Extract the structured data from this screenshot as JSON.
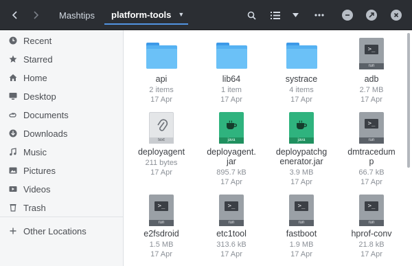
{
  "header": {
    "breadcrumb_home": "Mashtips",
    "breadcrumb_current": "platform-tools",
    "icons": {
      "back": "chevron-left-icon",
      "forward": "chevron-right-icon",
      "search": "search-icon",
      "view": "list-view-icon",
      "view_menu": "caret-down-icon",
      "menu": "more-icon",
      "minimize": "minimize-icon",
      "maximize": "maximize-icon",
      "close": "close-icon"
    }
  },
  "sidebar": {
    "items": [
      {
        "label": "Recent",
        "icon": "clock-icon"
      },
      {
        "label": "Starred",
        "icon": "star-icon"
      },
      {
        "label": "Home",
        "icon": "home-icon"
      },
      {
        "label": "Desktop",
        "icon": "desktop-icon"
      },
      {
        "label": "Documents",
        "icon": "documents-icon"
      },
      {
        "label": "Downloads",
        "icon": "download-icon"
      },
      {
        "label": "Music",
        "icon": "music-icon"
      },
      {
        "label": "Pictures",
        "icon": "pictures-icon"
      },
      {
        "label": "Videos",
        "icon": "videos-icon"
      },
      {
        "label": "Trash",
        "icon": "trash-icon"
      }
    ],
    "other_locations": "Other Locations"
  },
  "files": [
    {
      "name": "api",
      "meta1": "2 items",
      "meta2": "17 Apr",
      "type": "folder"
    },
    {
      "name": "lib64",
      "meta1": "1 item",
      "meta2": "17 Apr",
      "type": "folder"
    },
    {
      "name": "systrace",
      "meta1": "4 items",
      "meta2": "17 Apr",
      "type": "folder"
    },
    {
      "name": "adb",
      "meta1": "2.7 MB",
      "meta2": "17 Apr",
      "type": "executable",
      "badge": "run"
    },
    {
      "name": "deployagent",
      "meta1": "211 bytes",
      "meta2": "17 Apr",
      "type": "text",
      "badge": "text"
    },
    {
      "name": "deployagent.\njar",
      "meta1": "895.7 kB",
      "meta2": "17 Apr",
      "type": "java",
      "badge": "java"
    },
    {
      "name": "deploypatchg\nenerator.jar",
      "meta1": "3.9 MB",
      "meta2": "17 Apr",
      "type": "java",
      "badge": "java"
    },
    {
      "name": "dmtracedum\np",
      "meta1": "66.7 kB",
      "meta2": "17 Apr",
      "type": "executable",
      "badge": "run"
    },
    {
      "name": "e2fsdroid",
      "meta1": "1.5 MB",
      "meta2": "17 Apr",
      "type": "executable",
      "badge": "run"
    },
    {
      "name": "etc1tool",
      "meta1": "313.6 kB",
      "meta2": "17 Apr",
      "type": "executable",
      "badge": "run"
    },
    {
      "name": "fastboot",
      "meta1": "1.9 MB",
      "meta2": "17 Apr",
      "type": "executable",
      "badge": "run"
    },
    {
      "name": "hprof-conv",
      "meta1": "21.8 kB",
      "meta2": "17 Apr",
      "type": "executable",
      "badge": "run"
    }
  ],
  "colors": {
    "header_bg": "#2b2e33",
    "accent": "#5294e2",
    "folder": "#55b1f2",
    "java": "#2fb37e"
  }
}
